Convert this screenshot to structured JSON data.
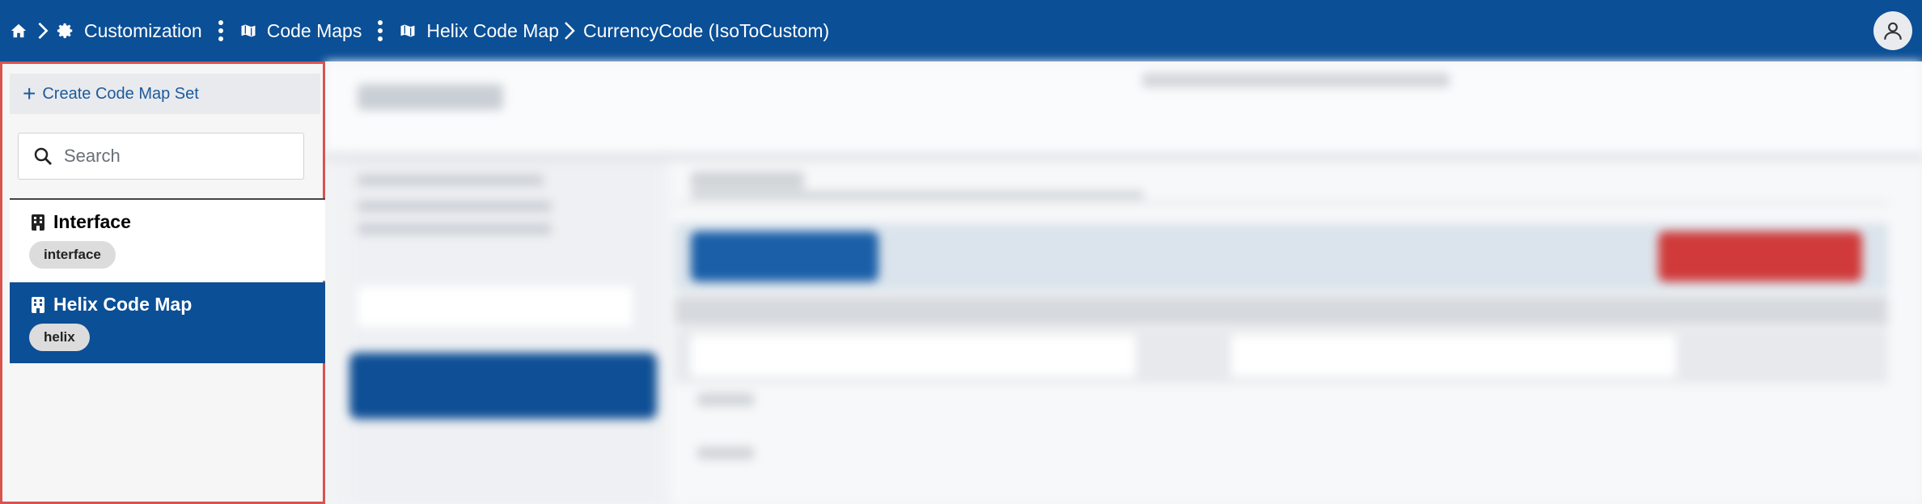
{
  "breadcrumb": {
    "home_icon": "home-icon",
    "customization": "Customization",
    "code_maps": "Code Maps",
    "helix_code_map": "Helix Code Map",
    "current": "CurrencyCode (IsoToCustom)"
  },
  "colors": {
    "topbar": "#0b4f96",
    "selected_item": "#0b4f96",
    "highlight_border": "#d9534f"
  },
  "sidebar": {
    "create_label": "Create Code Map Set",
    "search_placeholder": "Search",
    "items": [
      {
        "title": "Interface",
        "tag": "interface",
        "selected": false,
        "icon": "building-icon"
      },
      {
        "title": "Helix Code Map",
        "tag": "helix",
        "selected": true,
        "icon": "building-icon"
      }
    ]
  },
  "user": {
    "avatar_icon": "user-icon"
  }
}
